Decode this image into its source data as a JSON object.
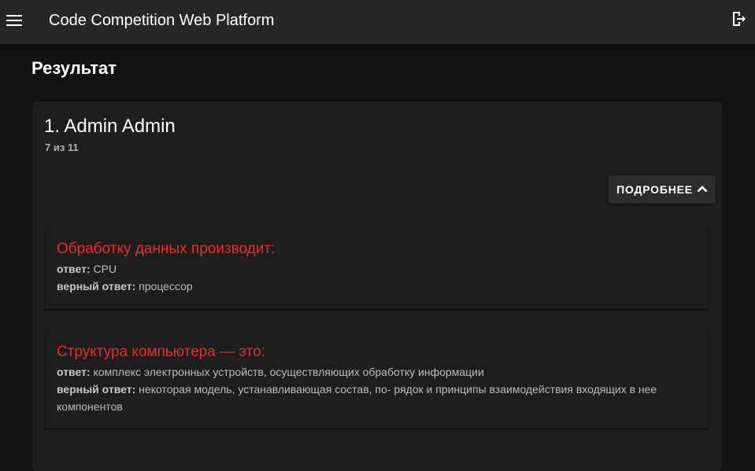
{
  "header": {
    "title": "Code Competition Web Platform",
    "menu_icon": "menu-icon",
    "logout_icon": "logout-icon"
  },
  "page": {
    "title": "Результат"
  },
  "result_card": {
    "heading": "1. Admin Admin",
    "score": "7 из 11",
    "details_button": {
      "label": "ПОДРОБНЕЕ",
      "icon": "chevron-up-icon"
    },
    "answer_label": "ответ:",
    "correct_label": "верный ответ:",
    "questions": [
      {
        "question": "Обработку данных производит:",
        "answer": "CPU",
        "correct": "процессор"
      },
      {
        "question": "Структура компьютера — это:",
        "answer": "комплекс электронных устройств, осуществляющих обработку информации",
        "correct": "некоторая модель, устанавливающая состав, по- рядок и принципы взаимодействия входящих в нее компонентов"
      }
    ]
  },
  "colors": {
    "background": "#121212",
    "appbar": "#272727",
    "card": "#1e1e1e",
    "question_red": "#ee2a2a"
  }
}
